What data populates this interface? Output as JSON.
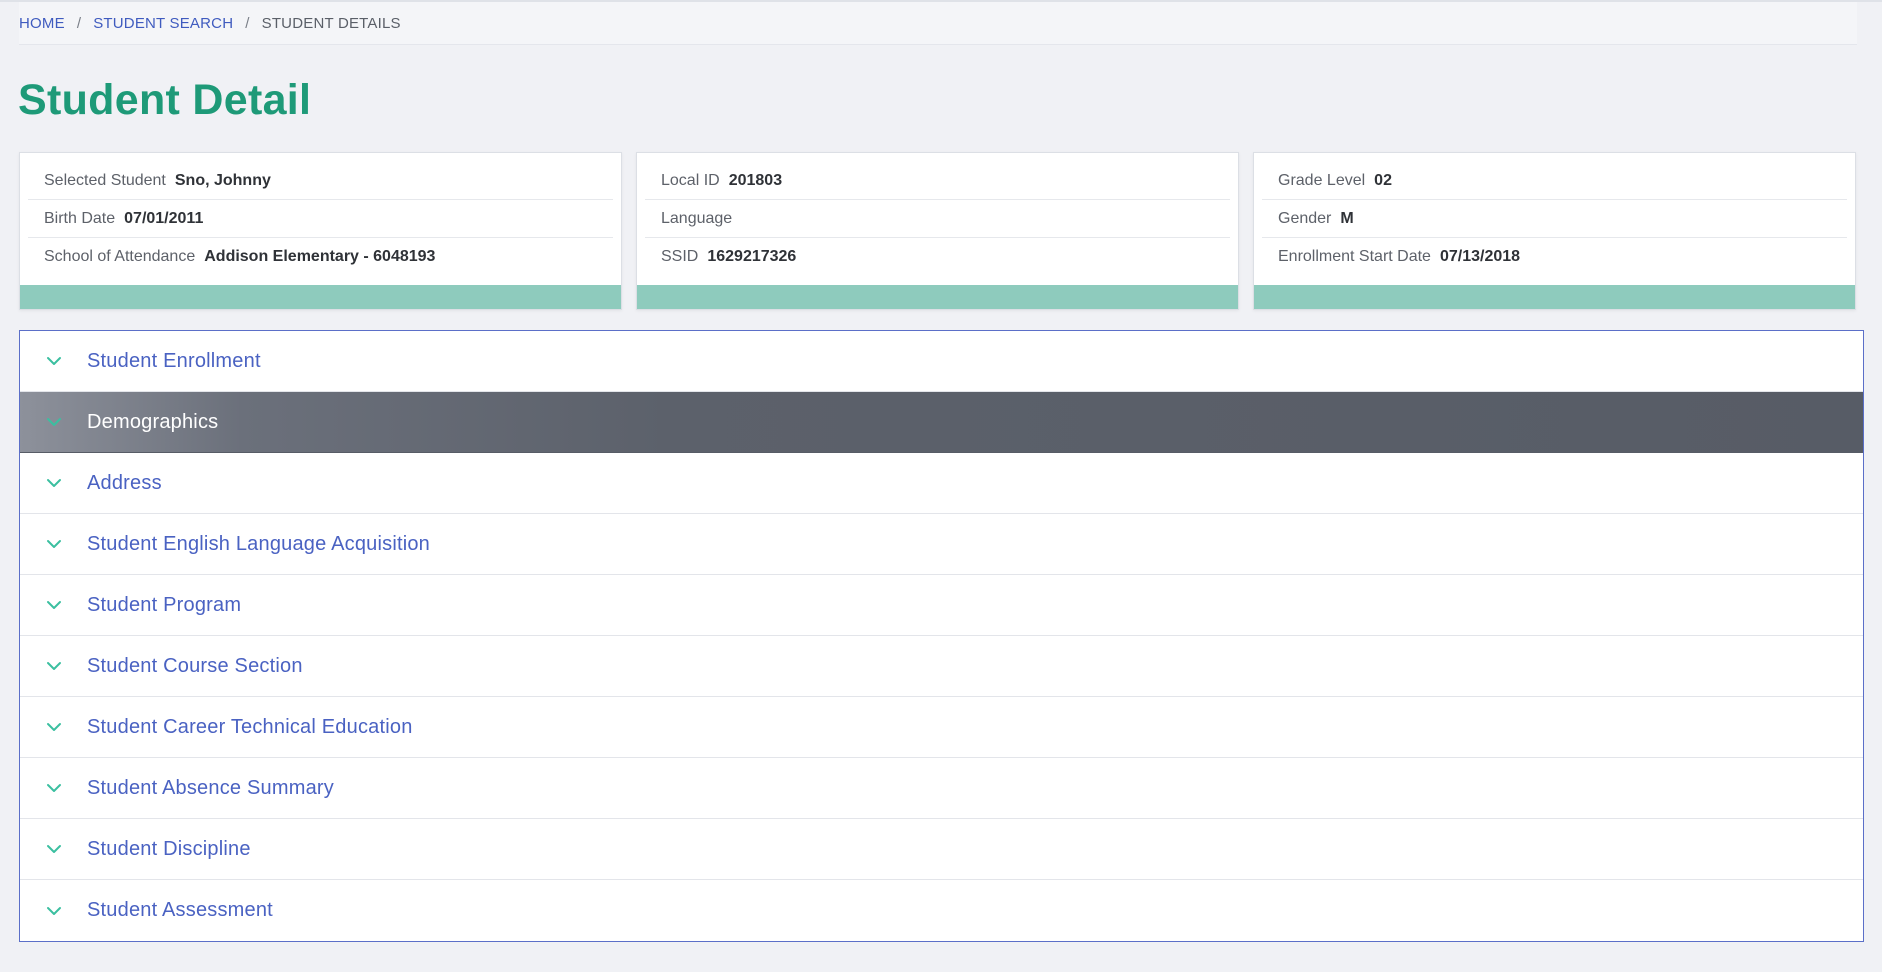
{
  "breadcrumb": {
    "home": "HOME",
    "search": "STUDENT SEARCH",
    "current": "STUDENT DETAILS",
    "separator": "/"
  },
  "page": {
    "title": "Student Detail"
  },
  "cards": [
    {
      "rows": [
        {
          "label": "Selected Student",
          "value": "Sno, Johnny"
        },
        {
          "label": "Birth Date",
          "value": "07/01/2011"
        },
        {
          "label": "School of Attendance",
          "value": "Addison Elementary - 6048193"
        }
      ]
    },
    {
      "rows": [
        {
          "label": "Local ID",
          "value": "201803"
        },
        {
          "label": "Language",
          "value": ""
        },
        {
          "label": "SSID",
          "value": "1629217326"
        }
      ]
    },
    {
      "rows": [
        {
          "label": "Grade Level",
          "value": "02"
        },
        {
          "label": "Gender",
          "value": "M"
        },
        {
          "label": "Enrollment Start Date",
          "value": "07/13/2018"
        }
      ]
    }
  ],
  "accordion": {
    "items": [
      {
        "title": "Student Enrollment"
      },
      {
        "title": "Demographics"
      },
      {
        "title": "Address"
      },
      {
        "title": "Student English Language Acquisition"
      },
      {
        "title": "Student Program"
      },
      {
        "title": "Student Course Section"
      },
      {
        "title": "Student Career Technical Education"
      },
      {
        "title": "Student Absence Summary"
      },
      {
        "title": "Student Discipline"
      },
      {
        "title": "Student Assessment"
      }
    ],
    "active_index": 1
  },
  "colors": {
    "title_green": "#1e9a78",
    "link_blue": "#4a62c2",
    "card_bar": "#8ecbbd",
    "chevron_teal": "#3bbfa0",
    "active_header": "#575c66"
  },
  "icons": {
    "accordion_chevron": "chevron-down-icon"
  }
}
